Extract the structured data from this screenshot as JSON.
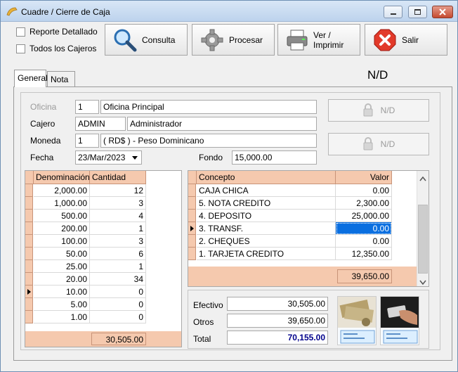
{
  "window": {
    "title": "Cuadre / Cierre de Caja"
  },
  "options": {
    "reporte_detallado": "Reporte Detallado",
    "todos_cajeros": "Todos los Cajeros"
  },
  "toolbar": {
    "consulta": "Consulta",
    "procesar": "Procesar",
    "imprimir": "Ver / Imprimir",
    "salir": "Salir"
  },
  "tabs": [
    {
      "label": "General"
    },
    {
      "label": "Nota"
    }
  ],
  "header_status": "N/D",
  "form": {
    "oficina_label": "Oficina",
    "oficina_code": "1",
    "oficina_name": "Oficina Principal",
    "cajero_label": "Cajero",
    "cajero_code": "ADMIN",
    "cajero_name": "Administrador",
    "moneda_label": "Moneda",
    "moneda_code": "1",
    "moneda_name": "( RD$ ) - Peso Dominicano",
    "fecha_label": "Fecha",
    "fecha_value": "23/Mar/2023",
    "fondo_label": "Fondo",
    "fondo_value": "15,000.00"
  },
  "side_buttons": [
    {
      "label": "N/D"
    },
    {
      "label": "N/D"
    }
  ],
  "denominations": {
    "headers": {
      "denominacion": "Denominación",
      "cantidad": "Cantidad"
    },
    "rows": [
      {
        "denominacion": "2,000.00",
        "cantidad": "12"
      },
      {
        "denominacion": "1,000.00",
        "cantidad": "3"
      },
      {
        "denominacion": "500.00",
        "cantidad": "4"
      },
      {
        "denominacion": "200.00",
        "cantidad": "1"
      },
      {
        "denominacion": "100.00",
        "cantidad": "3"
      },
      {
        "denominacion": "50.00",
        "cantidad": "6"
      },
      {
        "denominacion": "25.00",
        "cantidad": "1"
      },
      {
        "denominacion": "20.00",
        "cantidad": "34"
      },
      {
        "denominacion": "10.00",
        "cantidad": "0"
      },
      {
        "denominacion": "5.00",
        "cantidad": "0"
      },
      {
        "denominacion": "1.00",
        "cantidad": "0"
      }
    ],
    "total": "30,505.00"
  },
  "concepts": {
    "headers": {
      "concepto": "Concepto",
      "valor": "Valor"
    },
    "rows": [
      {
        "concepto": "CAJA CHICA",
        "valor": "0.00"
      },
      {
        "concepto": "5. NOTA CREDITO",
        "valor": "2,300.00"
      },
      {
        "concepto": "4. DEPOSITO",
        "valor": "25,000.00"
      },
      {
        "concepto": "3. TRANSF.",
        "valor": "0.00"
      },
      {
        "concepto": "2. CHEQUES",
        "valor": "0.00"
      },
      {
        "concepto": "1. TARJETA CREDITO",
        "valor": "12,350.00"
      }
    ],
    "total": "39,650.00"
  },
  "totals": {
    "efectivo_label": "Efectivo",
    "efectivo_value": "30,505.00",
    "otros_label": "Otros",
    "otros_value": "39,650.00",
    "total_label": "Total",
    "total_value": "70,155.00"
  },
  "colors": {
    "grid_header": "#f5c9ae",
    "selection": "#0a6fe0",
    "total_value": "#00008b"
  }
}
